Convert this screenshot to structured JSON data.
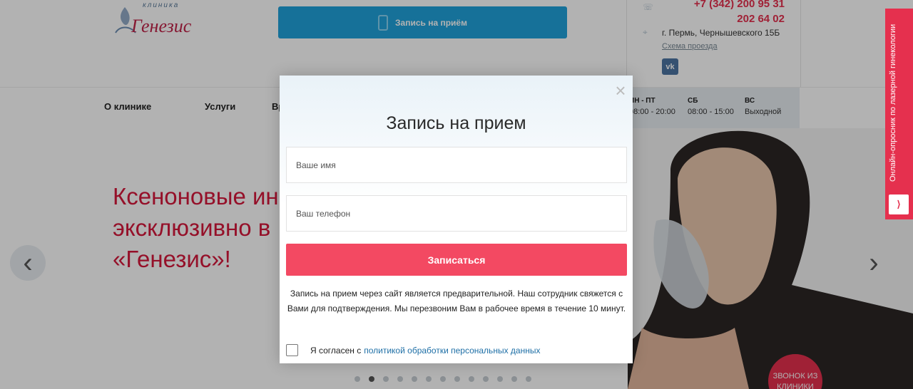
{
  "header": {
    "logo_small": "клиника",
    "logo_name": "Генезис",
    "appointment_button": "Запись на приём",
    "phone_line1": "+7 (342) 200 95 31",
    "phone_line2": "202 64 02",
    "address": "г. Пермь, Чернышевского 15Б",
    "map_link": "Схема проезда",
    "vk_label": "vk"
  },
  "nav": {
    "items": [
      "О клинике",
      "Услуги",
      "Вр"
    ],
    "hours": [
      {
        "day": "ПН - ПТ",
        "time": "08:00 - 20:00"
      },
      {
        "day": "СБ",
        "time": "08:00 - 15:00"
      },
      {
        "day": "ВС",
        "time": "Выходной"
      }
    ]
  },
  "hero": {
    "lines": [
      "Ксеноновые ин",
      "эксклюзивно в",
      "«Генезис»!"
    ],
    "dots_count": 13,
    "active_dot": 1,
    "call_button": "ЗВОНОК ИЗ КЛИНИКИ"
  },
  "side_tab": {
    "label": "Онлайн-опросник по лазерной гинекологии"
  },
  "modal": {
    "title": "Запись на прием",
    "name_placeholder": "Ваше имя",
    "phone_placeholder": "Ваш телефон",
    "submit_label": "Записаться",
    "note": "Запись на прием через сайт является предварительной. Наш сотрудник свяжется с Вами для подтверждения. Мы перезвоним Вам в рабочее время в течение 10 минут.",
    "agree_text": "Я согласен с",
    "policy_link": "политикой обработки персональных данных"
  },
  "colors": {
    "accent": "#e5304e",
    "button": "#f34962",
    "blue": "#20a3dc"
  }
}
